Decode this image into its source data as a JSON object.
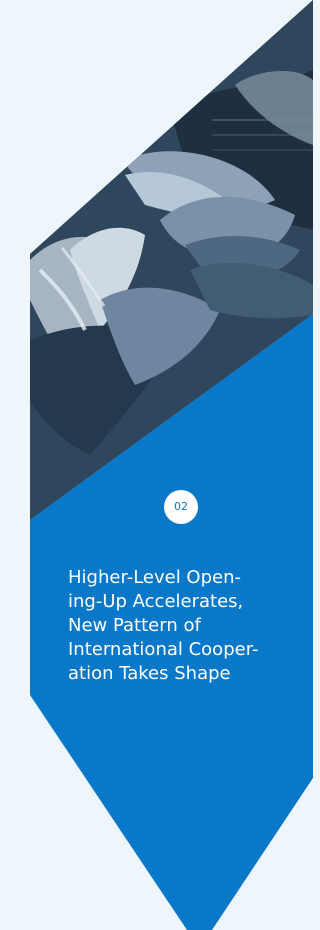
{
  "card": {
    "badge_number": "02",
    "title_lines": [
      "Higher-Level Open-",
      "ing-Up Accelerates,",
      "New Pattern of",
      "International Cooper-",
      "ation Takes Shape"
    ]
  },
  "colors": {
    "background": "#eef6fb",
    "panel_blue": "#0a78c8",
    "text": "#ffffff"
  },
  "image": {
    "subject": "hands-together-photo"
  }
}
